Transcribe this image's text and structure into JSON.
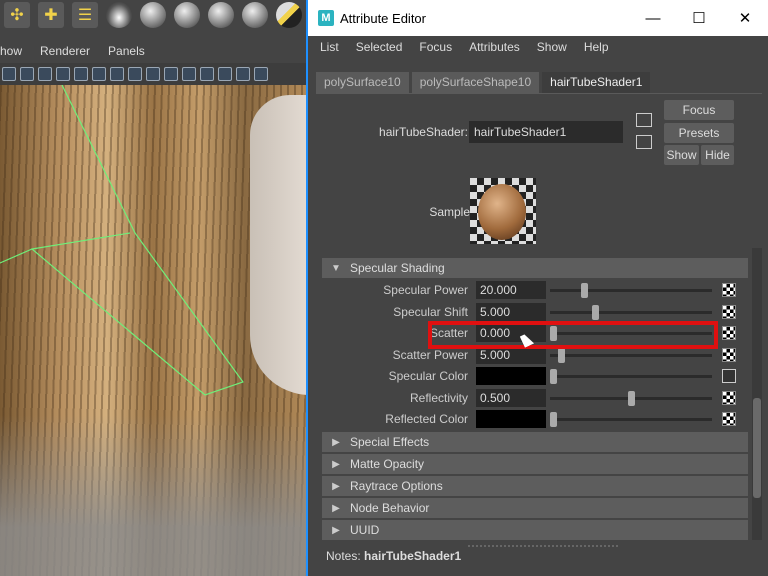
{
  "viewport": {
    "menu": [
      "how",
      "Renderer",
      "Panels"
    ]
  },
  "window": {
    "title": "Attribute Editor",
    "minimize": "—",
    "maximize": "☐",
    "close": "✕"
  },
  "menubar": [
    "List",
    "Selected",
    "Focus",
    "Attributes",
    "Show",
    "Help"
  ],
  "tabs": [
    {
      "label": "polySurface10",
      "active": false
    },
    {
      "label": "polySurfaceShape10",
      "active": false
    },
    {
      "label": "hairTubeShader1",
      "active": true
    }
  ],
  "shader": {
    "label": "hairTubeShader:",
    "value": "hairTubeShader1"
  },
  "buttons": {
    "focus": "Focus",
    "presets": "Presets",
    "show": "Show",
    "hide": "Hide"
  },
  "sample": {
    "label": "Sample"
  },
  "section": {
    "title": "Specular Shading"
  },
  "attributes": [
    {
      "label": "Specular Power",
      "value": "20.000",
      "slider": 0.2
    },
    {
      "label": "Specular Shift",
      "value": "5.000",
      "slider": 0.27
    },
    {
      "label": "Scatter",
      "value": "0.000",
      "slider": 0.0
    },
    {
      "label": "Scatter Power",
      "value": "5.000",
      "slider": 0.05
    },
    {
      "label": "Specular Color",
      "value": "",
      "color": "#000000",
      "slider": 0.0
    },
    {
      "label": "Reflectivity",
      "value": "0.500",
      "slider": 0.5
    },
    {
      "label": "Reflected Color",
      "value": "",
      "color": "#000000",
      "slider": 0.0
    }
  ],
  "collapsed_sections": [
    "Special Effects",
    "Matte Opacity",
    "Raytrace Options",
    "Node Behavior",
    "UUID"
  ],
  "notes": {
    "label": "Notes:",
    "value": "hairTubeShader1"
  },
  "colors": {
    "highlight": "#e01010",
    "window_border": "#1e90ff",
    "panel_bg": "#444444"
  }
}
